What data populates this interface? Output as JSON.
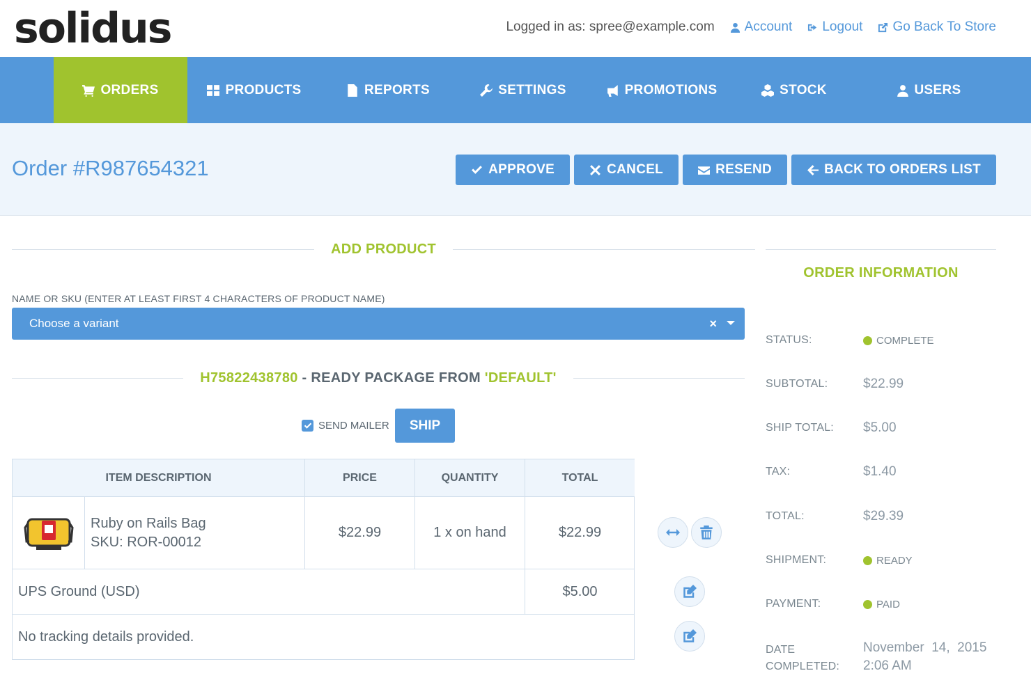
{
  "header": {
    "logo": "solidus",
    "logged_in": "Logged in as: spree@example.com",
    "account": "Account",
    "logout": "Logout",
    "back_to_store": "Go Back To Store"
  },
  "nav": [
    {
      "label": "ORDERS",
      "icon": "cart-icon"
    },
    {
      "label": "PRODUCTS",
      "icon": "grid-icon"
    },
    {
      "label": "REPORTS",
      "icon": "file-icon"
    },
    {
      "label": "SETTINGS",
      "icon": "wrench-icon"
    },
    {
      "label": "PROMOTIONS",
      "icon": "bullhorn-icon"
    },
    {
      "label": "STOCK",
      "icon": "cubes-icon"
    },
    {
      "label": "USERS",
      "icon": "user-icon"
    }
  ],
  "page": {
    "title": "Order #R987654321",
    "approve": "APPROVE",
    "cancel": "CANCEL",
    "resend": "RESEND",
    "back_to_list": "BACK TO ORDERS LIST"
  },
  "add_product": {
    "title": "ADD PRODUCT",
    "field_label": "NAME OR SKU (ENTER AT LEAST FIRST 4 CHARACTERS OF PRODUCT NAME)",
    "placeholder": "Choose a variant",
    "clear": "×"
  },
  "shipment": {
    "number": "H75822438780",
    "status_text": " - READY PACKAGE FROM ",
    "location": "'DEFAULT'",
    "send_mailer": "SEND MAILER",
    "ship": "SHIP",
    "headers": {
      "desc": "ITEM DESCRIPTION",
      "price": "PRICE",
      "qty": "QUANTITY",
      "total": "TOTAL"
    },
    "item": {
      "name": "Ruby on Rails Bag",
      "sku": "SKU: ROR-00012",
      "price": "$22.99",
      "qty": "1 x on hand",
      "total": "$22.99"
    },
    "shipping_method": "UPS Ground (USD)",
    "shipping_cost": "$5.00",
    "tracking": "No tracking details provided."
  },
  "order_info": {
    "title": "ORDER INFORMATION",
    "status_label": "STATUS:",
    "status": "COMPLETE",
    "subtotal_label": "SUBTOTAL:",
    "subtotal": "$22.99",
    "ship_total_label": "SHIP TOTAL:",
    "ship_total": "$5.00",
    "tax_label": "TAX:",
    "tax": "$1.40",
    "total_label": "TOTAL:",
    "total": "$29.39",
    "shipment_label": "SHIPMENT:",
    "shipment": "READY",
    "payment_label": "PAYMENT:",
    "payment": "PAID",
    "date_label_1": "DATE",
    "date_label_2": "COMPLETED:",
    "date_1": "November  14,  2015",
    "date_2": "2:06 AM"
  },
  "colors": {
    "primary": "#5498da",
    "accent": "#a0c32e",
    "light": "#eef5fc"
  }
}
